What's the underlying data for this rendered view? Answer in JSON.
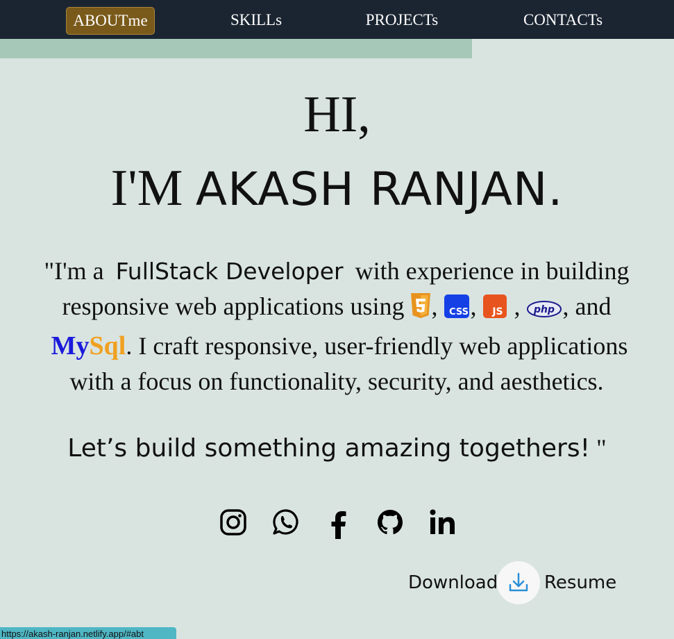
{
  "nav": {
    "items": [
      {
        "label": "ABOUTme",
        "active": true
      },
      {
        "label": "SKILLs",
        "active": false
      },
      {
        "label": "PROJECTs",
        "active": false
      },
      {
        "label": "CONTACTs",
        "active": false
      }
    ]
  },
  "scroll_progress": 0.7,
  "hero": {
    "greeting": "HI,",
    "im": "I'M ",
    "name": "AKASH RANJAN."
  },
  "intro": {
    "p1": "\"I'm a",
    "role": "FullStack Developer",
    "p2": "with experience in building responsive web applications using",
    "c1": ",",
    "c2": ",",
    "c3": ",",
    "c4": ", and",
    "my": "My",
    "sql": "Sql",
    "p3": ". I craft responsive, user-friendly web applications with a focus on functionality, security, and aesthetics.",
    "icons": [
      "html5-icon",
      "css3-icon",
      "javascript-icon",
      "php-icon"
    ],
    "css_label": "CSS",
    "js_label": "JS",
    "php_label": "php"
  },
  "cta": {
    "text": "Let’s build something amazing togethers!",
    "quote": " \""
  },
  "socials": [
    "instagram-icon",
    "whatsapp-icon",
    "facebook-icon",
    "github-icon",
    "linkedin-icon"
  ],
  "download": {
    "left": "Download",
    "right": "Resume",
    "icon": "download-icon",
    "accent": "#2a8fd8"
  },
  "status_url": "https://akash-ranjan.netlify.app/#abt"
}
